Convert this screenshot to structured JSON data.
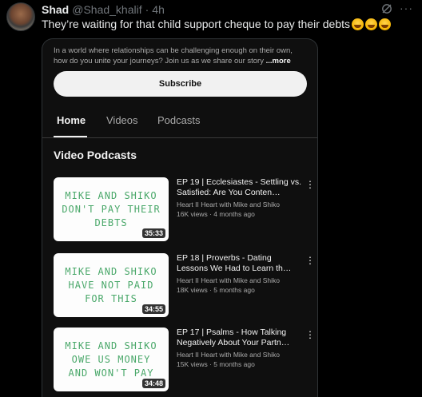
{
  "tweet": {
    "name": "Shad",
    "handle": "@Shad_khalif",
    "separator": "·",
    "time": "4h",
    "text": "They’re waiting for that child support cheque to pay their debts",
    "emojis": [
      "rofl-emoji",
      "rofl-emoji",
      "rofl-emoji"
    ]
  },
  "channel_page": {
    "description": "In a world where relationships can be challenging enough on their own, how do you unite your journeys? Join us as we share our story",
    "description_more": "...more",
    "subscribe_label": "Subscribe",
    "tabs": [
      {
        "label": "Home",
        "active": true
      },
      {
        "label": "Videos",
        "active": false
      },
      {
        "label": "Podcasts",
        "active": false
      }
    ],
    "section_title": "Video Podcasts",
    "videos": [
      {
        "thumb_text": "MIKE AND SHIKO\nDON'T PAY THEIR\nDEBTS",
        "duration": "35:33",
        "title": "EP 19 | Ecclesiastes - Settling vs. Satisfied: Are You Conten…",
        "channel": "Heart II Heart with Mike and Shiko",
        "meta": "16K views · 4 months ago"
      },
      {
        "thumb_text": "MIKE AND SHIKO\nHAVE NOT PAID\nFOR THIS",
        "duration": "34:55",
        "title": "EP 18 | Proverbs - Dating Lessons We Had to Learn th…",
        "channel": "Heart II Heart with Mike and Shiko",
        "meta": "18K views · 5 months ago"
      },
      {
        "thumb_text": "MIKE AND SHIKO\nOWE US MONEY\nAND WON'T PAY",
        "duration": "34:48",
        "title": "EP 17 | Psalms - How Talking Negatively About Your Partn…",
        "channel": "Heart II Heart with Mike and Shiko",
        "meta": "15K views · 5 months ago"
      }
    ]
  },
  "colors": {
    "background": "#000000",
    "screenshot_bg": "#0f0f0f",
    "thumb_text": "#4aa86a",
    "subscribe_bg": "#f1f1f1"
  },
  "icons": {
    "grok": "grok-icon",
    "more": "more-icon",
    "kebab": "kebab-menu-icon"
  }
}
